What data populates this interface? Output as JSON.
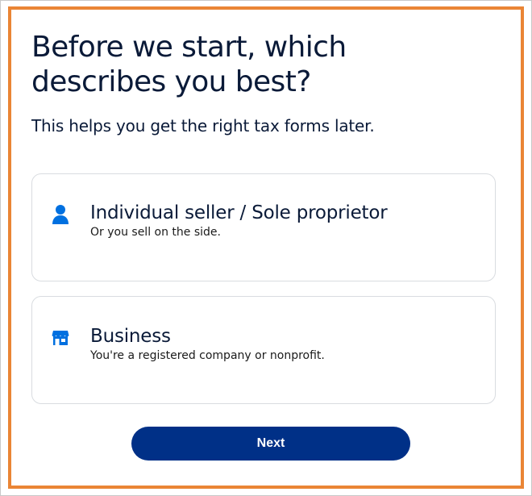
{
  "header": {
    "title": "Before we start, which describes you best?",
    "subtitle": "This helps you get the right tax forms later."
  },
  "options": [
    {
      "icon": "person-icon",
      "title": "Individual seller / Sole proprietor",
      "description": "Or you sell on the side."
    },
    {
      "icon": "storefront-icon",
      "title": "Business",
      "description": "You're a registered company or nonprofit."
    }
  ],
  "actions": {
    "next_label": "Next"
  },
  "colors": {
    "heading": "#0a1a38",
    "icon": "#0070e0",
    "button": "#003087",
    "highlight_border": "#ea8535",
    "card_border": "#d9dce0"
  }
}
